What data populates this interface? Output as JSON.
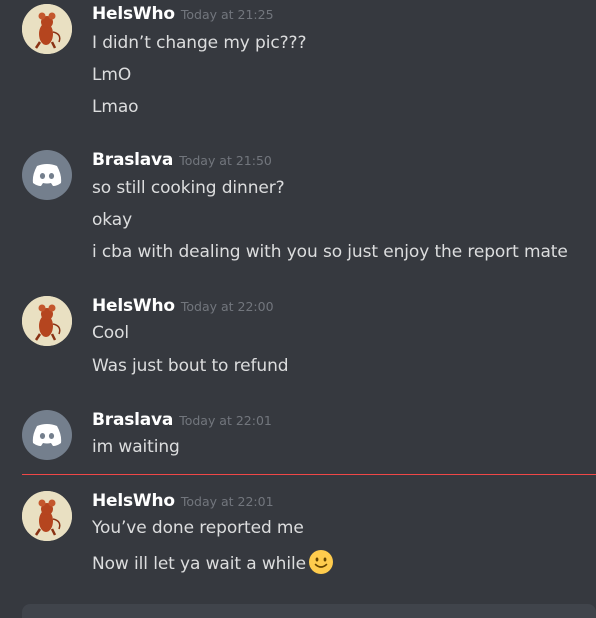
{
  "messages": [
    {
      "username": "HelsWho",
      "timestamp": "Today at 21:25",
      "avatar": "jerry-mouse-avatar",
      "lines": [
        "I didn’t change my pic???",
        "LmO",
        "Lmao"
      ]
    },
    {
      "username": "Braslava",
      "timestamp": "Today at 21:50",
      "avatar": "discord-default-avatar",
      "lines": [
        "so still cooking dinner?",
        "okay",
        "i cba with dealing with you so just enjoy the report mate"
      ]
    },
    {
      "username": "HelsWho",
      "timestamp": "Today at 22:00",
      "avatar": "jerry-mouse-avatar",
      "lines": [
        "Cool",
        "Was just bout to refund"
      ]
    },
    {
      "username": "Braslava",
      "timestamp": "Today at 22:01",
      "avatar": "discord-default-avatar",
      "lines": [
        "im waiting"
      ]
    },
    {
      "username": "HelsWho",
      "timestamp": "Today at 22:01",
      "avatar": "jerry-mouse-avatar",
      "lines": [
        "You’ve done reported me",
        "Now ill let ya wait a while"
      ]
    }
  ],
  "colors": {
    "background": "#36393f",
    "username": "#ffffff",
    "timestamp": "#72767d",
    "text": "#dcddde",
    "new_messages_divider": "#f04747",
    "discord_avatar": "#747f8d"
  },
  "icons": {
    "emoji": "slightly-smiling-face-emoji"
  }
}
